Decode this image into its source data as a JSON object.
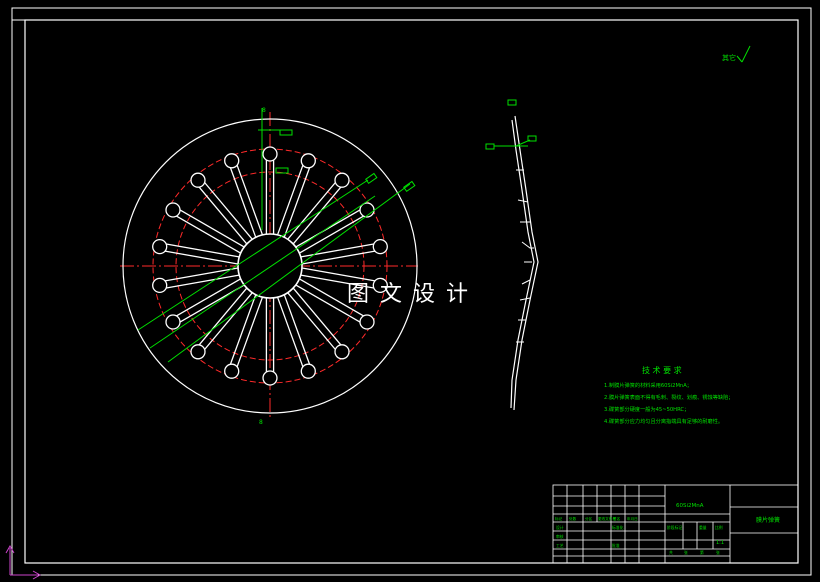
{
  "watermark": "图 文 设 计",
  "corner_note": "其它",
  "part_label": "8",
  "tech_title": "技 术 要 求",
  "tech_notes": [
    "1.制膜片弹簧的材料采用60Si2MnA；",
    "2.膜片弹簧表面不得有毛刺、裂纹、划痕、锈蚀等缺陷；",
    "3.碟簧部分硬度一般为45~50HRC；",
    "4.碟簧部分应力均匀且分离指端具有足够的耐磨性。"
  ],
  "title_block": {
    "material": "60Si2MnA",
    "part_name": "膜片弹簧",
    "scale": "1:1",
    "header_cells": [
      "标记",
      "处数",
      "分区",
      "更改文件号",
      "签名",
      "年月日"
    ],
    "role_cells": [
      "设计",
      "审核",
      "工艺",
      "标准化",
      "批准"
    ],
    "stage_cells": [
      "阶段标记",
      "重量",
      "比例"
    ],
    "sheet_cells": [
      "共",
      "张",
      "第",
      "张"
    ]
  },
  "colors": {
    "background": "#000000",
    "outline": "#ffffff",
    "centerline": "#ff2a2a",
    "annotation": "#00e000",
    "ucs": "#cc44cc"
  }
}
